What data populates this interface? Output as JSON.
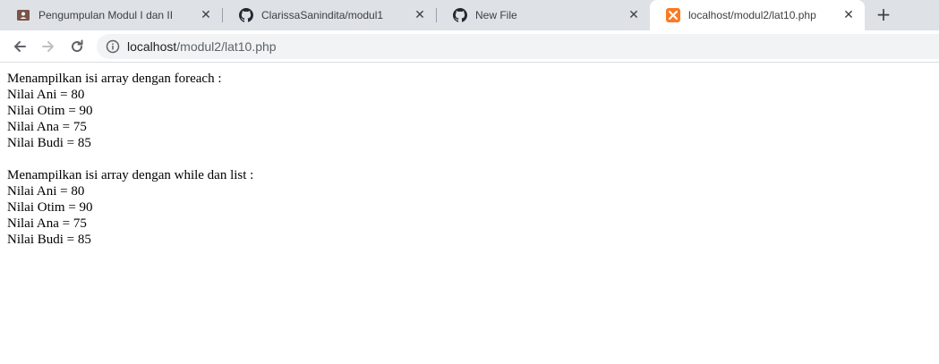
{
  "tabs": [
    {
      "title": "Pengumpulan Modul I dan II",
      "icon": "classroom-icon"
    },
    {
      "title": "ClarissaSanindita/modul1",
      "icon": "github-icon"
    },
    {
      "title": "New File",
      "icon": "github-icon"
    },
    {
      "title": "localhost/modul2/lat10.php",
      "icon": "xampp-icon",
      "active": true
    }
  ],
  "address_bar": {
    "host": "localhost",
    "path": "/modul2/lat10.php"
  },
  "page": {
    "sections": [
      {
        "heading": "Menampilkan isi array dengan foreach :",
        "lines": [
          "Nilai Ani = 80",
          "Nilai Otim = 90",
          "Nilai Ana = 75",
          "Nilai Budi = 85"
        ]
      },
      {
        "heading": "Menampilkan isi array dengan while dan list :",
        "lines": [
          "Nilai Ani = 80",
          "Nilai Otim = 90",
          "Nilai Ana = 75",
          "Nilai Budi = 85"
        ]
      }
    ]
  },
  "colors": {
    "tabstrip_bg": "#dee1e6",
    "omnibox_bg": "#f1f3f4",
    "xampp_orange": "#fb7a24",
    "classroom_brown": "#795548"
  }
}
